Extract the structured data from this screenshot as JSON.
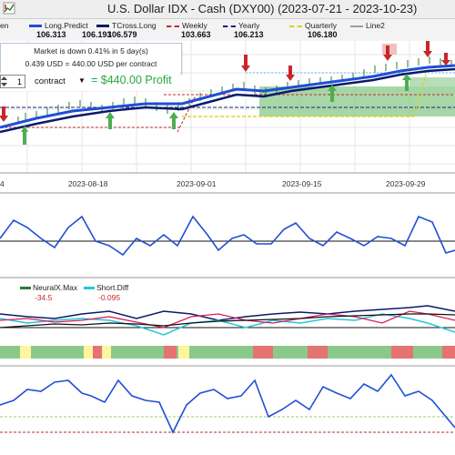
{
  "window": {
    "title": "U.S. Dollar IDX - Cash (DXY00) (2023-07-21 - 2023-10-23)"
  },
  "legend": [
    {
      "name": "en",
      "value": "106.313",
      "color": "#000000"
    },
    {
      "name": "Long.Predict",
      "value": "106.193",
      "color": "#1f4fd6"
    },
    {
      "name": "TCross.Long",
      "value": "106.579",
      "color": "#0a1a6a"
    },
    {
      "name": "Weekly",
      "value": "103.663",
      "color": "#c62828"
    },
    {
      "name": "Yearly",
      "value": "106.213",
      "color": "#1a237e"
    },
    {
      "name": "Quarterly",
      "value": "106.180",
      "color": "#d4d400"
    },
    {
      "name": "Line2",
      "value": "",
      "color": "#9e9e9e"
    }
  ],
  "info": {
    "line1": "Market is down 0.41% in 5 day(s)",
    "line2": "0.439 USD = 440.00 USD per contract"
  },
  "calc": {
    "qty": "1",
    "unit": "contract",
    "profit": "= $440.00 Profit"
  },
  "xaxis": [
    "4",
    "2023-08-18",
    "2023-09-01",
    "2023-09-15",
    "2023-09-29"
  ],
  "indicators": [
    {
      "name": "NeuralX.Max",
      "value": "-34.5",
      "color": "#2e7d32"
    },
    {
      "name": "Short.Diff",
      "value": "-0.095",
      "color": "#26c6da"
    }
  ],
  "colors": {
    "green_band": "#8bc98a",
    "bar_green": "#6bbf6b",
    "bar_red": "#e57373",
    "bar_yellow": "#fff59d"
  }
}
